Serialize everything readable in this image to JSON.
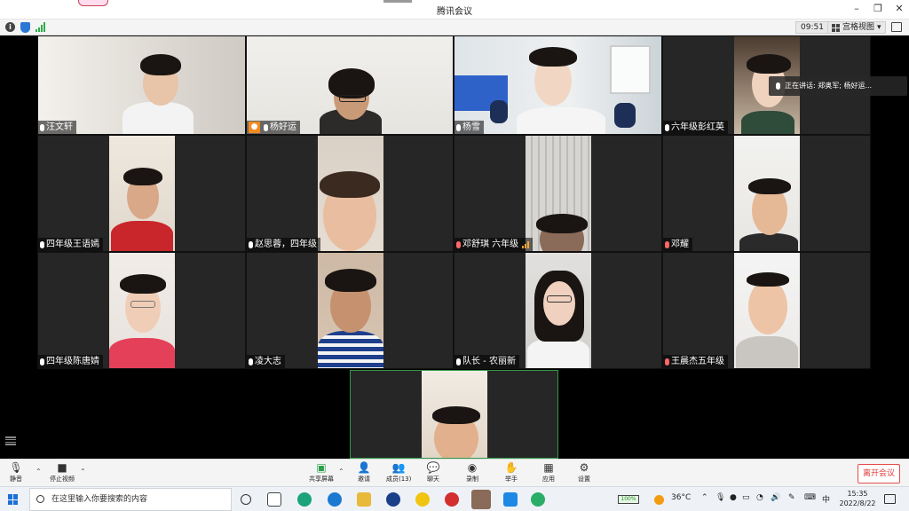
{
  "window": {
    "title": "腾讯会议",
    "controls": [
      "minimize",
      "restore",
      "close"
    ]
  },
  "infobar": {
    "timer": "09:51",
    "view_label": "宫格视图"
  },
  "speaking": {
    "label": "正在讲话: 郑奥军; 杨好运..."
  },
  "participants": [
    {
      "name": "汪文轩",
      "muted": false
    },
    {
      "name": "杨好运",
      "muted": false,
      "host": true
    },
    {
      "name": "杨雪",
      "muted": false
    },
    {
      "name": "六年级彭红英",
      "muted": false
    },
    {
      "name": "四年级王语嫣",
      "muted": false
    },
    {
      "name": "赵思蓉，四年级",
      "muted": false
    },
    {
      "name": "邓舒琪 六年级",
      "muted": true,
      "weak_signal": true
    },
    {
      "name": "邓耀",
      "muted": true
    },
    {
      "name": "四年级陈唐婧",
      "muted": false
    },
    {
      "name": "凌大志",
      "muted": false
    },
    {
      "name": "队长 - 农丽新",
      "muted": false
    },
    {
      "name": "王晨杰五年级",
      "muted": true
    },
    {
      "name": "",
      "muted": false
    }
  ],
  "toolbar": {
    "mute": "静音",
    "stop_video": "停止视频",
    "share_screen": "共享屏幕",
    "invite": "邀请",
    "members": "成员(13)",
    "chat": "聊天",
    "record": "录制",
    "raise_hand": "举手",
    "apps": "应用",
    "settings": "设置",
    "leave": "离开会议"
  },
  "taskbar": {
    "search_placeholder": "在这里输入你要搜索的内容",
    "battery": "100%",
    "temperature": "36°C",
    "ime": "中",
    "time": "15:35",
    "date": "2022/8/22"
  }
}
